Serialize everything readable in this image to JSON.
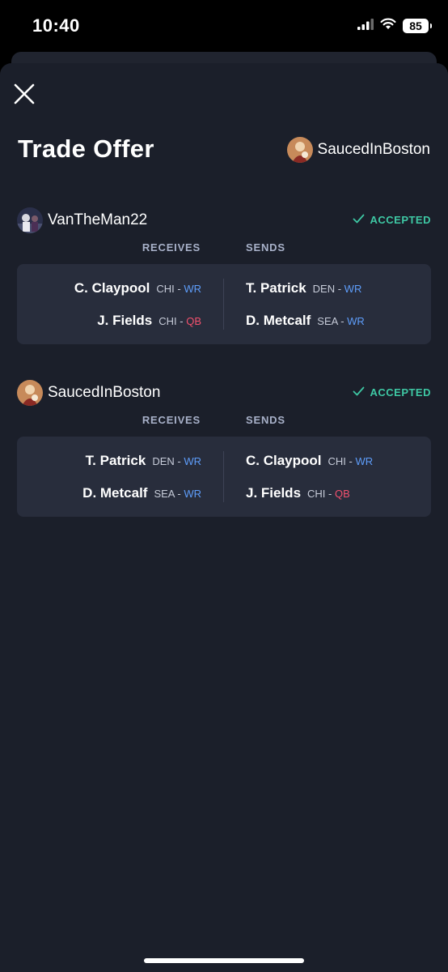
{
  "status_bar": {
    "time": "10:40",
    "battery": "85"
  },
  "header": {
    "title": "Trade Offer",
    "user": "SaucedInBoston"
  },
  "sections": [
    {
      "user": "VanTheMan22",
      "status": "ACCEPTED",
      "receives_label": "RECEIVES",
      "sends_label": "SENDS",
      "receives": [
        {
          "name": "C. Claypool",
          "team": "CHI",
          "sep": " - ",
          "pos": "WR"
        },
        {
          "name": "J. Fields",
          "team": "CHI",
          "sep": " - ",
          "pos": "QB"
        }
      ],
      "sends": [
        {
          "name": "T. Patrick",
          "team": "DEN",
          "sep": " - ",
          "pos": "WR"
        },
        {
          "name": "D. Metcalf",
          "team": "SEA",
          "sep": " - ",
          "pos": "WR"
        }
      ]
    },
    {
      "user": "SaucedInBoston",
      "status": "ACCEPTED",
      "receives_label": "RECEIVES",
      "sends_label": "SENDS",
      "receives": [
        {
          "name": "T. Patrick",
          "team": "DEN",
          "sep": " - ",
          "pos": "WR"
        },
        {
          "name": "D. Metcalf",
          "team": "SEA",
          "sep": " - ",
          "pos": "WR"
        }
      ],
      "sends": [
        {
          "name": "C. Claypool",
          "team": "CHI",
          "sep": " - ",
          "pos": "WR"
        },
        {
          "name": "J. Fields",
          "team": "CHI",
          "sep": " - ",
          "pos": "QB"
        }
      ]
    }
  ],
  "colors": {
    "accepted": "#3ec8a4",
    "wr": "#5e9dfa",
    "qb": "#f2516e",
    "sheet": "#1b1f2a",
    "card": "#282d3c"
  },
  "icons": {
    "close": "close-icon",
    "check": "check-icon",
    "signal": "signal-icon",
    "wifi": "wifi-icon",
    "battery": "battery-icon"
  }
}
